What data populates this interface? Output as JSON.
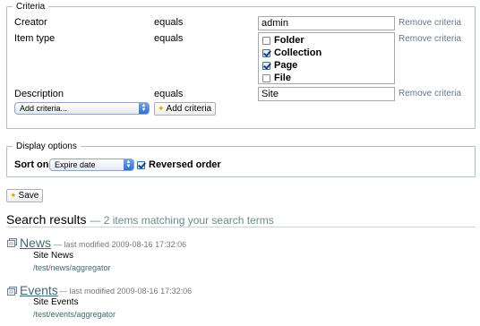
{
  "criteria": {
    "legend": "Criteria",
    "rows": [
      {
        "label": "Creator",
        "operator": "equals",
        "value": "admin",
        "remove": "Remove criteria"
      },
      {
        "label": "Item type",
        "operator": "equals",
        "remove": "Remove criteria"
      },
      {
        "label": "Description",
        "operator": "equals",
        "value": "Site",
        "remove": "Remove criteria"
      }
    ],
    "types": [
      {
        "label": "Folder",
        "checked": false
      },
      {
        "label": "Collection",
        "checked": true
      },
      {
        "label": "Page",
        "checked": true
      },
      {
        "label": "File",
        "checked": false
      }
    ],
    "add_select": "Add criteria...",
    "add_button": "Add criteria"
  },
  "display": {
    "legend": "Display options",
    "sort_label": "Sort on",
    "sort_value": "Expire date",
    "reversed_label": "Reversed order",
    "reversed_checked": true
  },
  "save_label": "Save",
  "results": {
    "title": "Search results",
    "subtitle": "— 2 items matching your search terms",
    "items": [
      {
        "title": "News",
        "meta": "— last modified 2009-08-16 17:32:06",
        "desc": "Site News",
        "path": "/test/news/aggregator"
      },
      {
        "title": "Events",
        "meta": "— last modified 2009-08-16 17:32:06",
        "desc": "Site Events",
        "path": "/test/events/aggregator"
      }
    ]
  }
}
